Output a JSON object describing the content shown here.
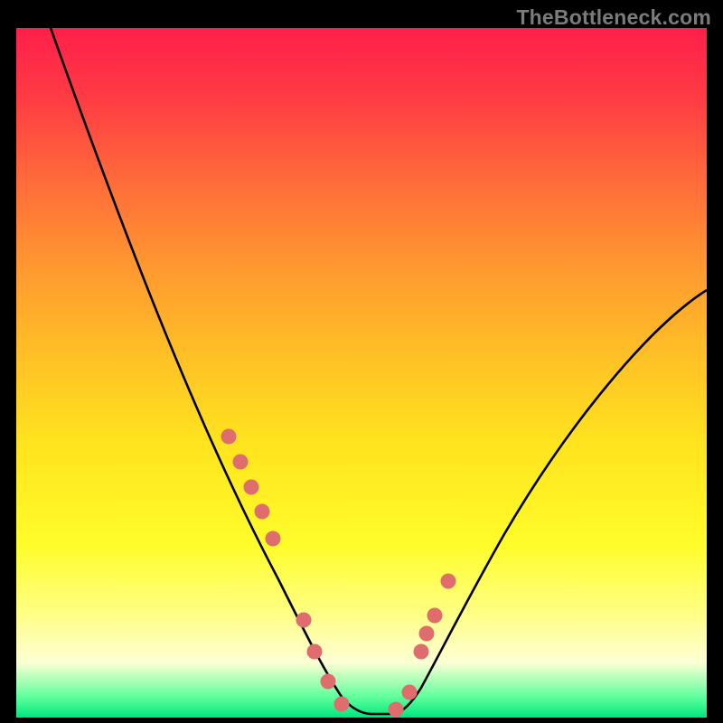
{
  "watermark": {
    "text": "TheBottleneck.com"
  },
  "colors": {
    "frame": "#000000",
    "curve": "#000000",
    "dots": "#e06d6d",
    "gradient_stops": [
      "#ff1f4a",
      "#ff3b44",
      "#ff6a3a",
      "#ff8f32",
      "#ffb928",
      "#ffe31e",
      "#fffc2a",
      "#ffff86",
      "#fdffd4",
      "#5fff9c",
      "#00e77e"
    ]
  },
  "chart_data": {
    "type": "line",
    "title": "",
    "xlabel": "",
    "ylabel": "",
    "xlim": [
      0,
      100
    ],
    "ylim": [
      0,
      100
    ],
    "grid": false,
    "legend": false,
    "note": "V-shaped bottleneck curve; y ≈ mismatch %, minimum near x≈50. Values estimated from pixels.",
    "series": [
      {
        "name": "bottleneck-curve",
        "x": [
          5,
          10,
          15,
          20,
          25,
          30,
          35,
          40,
          44,
          46,
          48,
          50,
          52,
          54,
          56,
          60,
          65,
          70,
          75,
          80,
          85,
          90,
          95,
          100
        ],
        "y": [
          100,
          88,
          76,
          64,
          53,
          42,
          31,
          20,
          8,
          4,
          1,
          0,
          0,
          1,
          3,
          8,
          14,
          21,
          28,
          35,
          42,
          49,
          55,
          62
        ]
      }
    ],
    "markers": {
      "name": "highlighted-points",
      "note": "salmon dots along the curve near the valley",
      "x": [
        30,
        32,
        34,
        36,
        38,
        42,
        44,
        46,
        48,
        54,
        56,
        58,
        58.5,
        60,
        62
      ],
      "y": [
        41,
        37,
        33,
        29,
        25,
        13,
        8,
        4,
        1,
        1,
        4,
        10,
        12,
        15,
        20
      ]
    }
  }
}
